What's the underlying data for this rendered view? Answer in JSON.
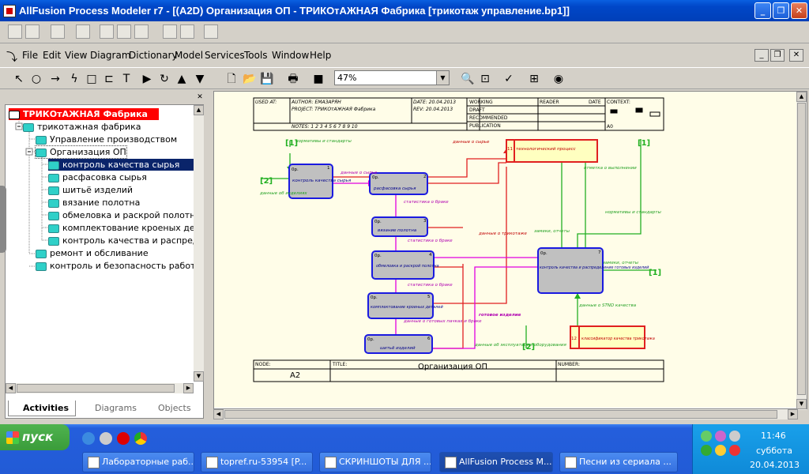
{
  "window": {
    "title": "AllFusion Process Modeler r7 - [(A2D) Организация ОП - ТРИКОтАЖНАЯ Фабрика  [трикотаж управление.bp1]]"
  },
  "menu": [
    "File",
    "Edit",
    "View",
    "Diagram",
    "Dictionary",
    "Model",
    "Services",
    "Tools",
    "Window",
    "Help"
  ],
  "toolbar": {
    "zoom": "47%"
  },
  "tree": {
    "root": "ТРИКОтАЖНАЯ Фабрика",
    "items": [
      "трикотажная фабрика",
      "Управление производством",
      "Организация ОП",
      "контроль  качества  сырья",
      "расфасовка сырья",
      "шитьё изделий",
      "вязание  полотна",
      "обмеловка и  раскрой полотна",
      "комплектование  кроеных  дета",
      "контроль качества и  распреде",
      "ремонт и обсливание",
      "контроль и  безопасность работ"
    ]
  },
  "tabs": {
    "activities": "Activities",
    "diagrams": "Diagrams",
    "objects": "Objects"
  },
  "diagram": {
    "header": {
      "used_at": "USED AT:",
      "author": "AUTHOR:  ЕМАЗАРЯН",
      "project": "PROJECT:  ТРИКОтАЖНАЯ Фабрика",
      "date": "DATE: 20.04.2013",
      "rev": "REV:   20.04.2013",
      "notes": "NOTES:  1  2  3  4  5  6  7  8  9  10",
      "working": "WORKING",
      "draft": "DRAFT",
      "recommended": "RECOMMENDED",
      "publication": "PUBLICATION",
      "reader": "READER",
      "date2": "DATE",
      "context": "CONTEXT:",
      "a0": "A0"
    },
    "footer": {
      "node": "NODE:",
      "node_val": "A2",
      "title": "TITLE:",
      "title_val": "Организация ОП",
      "number": "NUMBER:"
    },
    "boxes": [
      {
        "text": "контроль качества сырья",
        "num": "1",
        "tag": "0р."
      },
      {
        "text": "расфасовка сырья",
        "num": "2",
        "tag": "0р."
      },
      {
        "text": "вязание  полотна",
        "num": "3",
        "tag": "0р."
      },
      {
        "text": "обмеловка и раскрой полотна",
        "num": "4",
        "tag": "0р."
      },
      {
        "text": "комплектование кроеных деталей",
        "num": "5",
        "tag": "0р."
      },
      {
        "text": "шитьё изделий",
        "num": "6",
        "tag": "0р."
      },
      {
        "text": "контроль качества и распределение готовых изделий",
        "num": "7",
        "tag": "0р."
      }
    ],
    "refs": [
      {
        "text": "технологический процесс",
        "num": "11"
      },
      {
        "text": "классификатор качества трикотажа",
        "num": "12"
      }
    ],
    "labels": [
      "нормативы и стандарты",
      "данные о сырье",
      "данные о сырье",
      "данные об изделиях",
      "статистика о браке",
      "статистика о браке",
      "статистика о браке",
      "данные о трикотаже",
      "отметка о выполнении",
      "нормативы и стандарты",
      "замеки, отчеты",
      "замеки, отчеты",
      "данные о готовых пачках и браке",
      "готовое изделие",
      "данные об эксплуатации оборудования",
      "данные о STND качества"
    ],
    "tunnels": [
      "[1]",
      "[1]",
      "[2]",
      "[1]",
      "[2]"
    ]
  },
  "taskbar": {
    "start": "пуск",
    "tasks": [
      "Лабораторные раб...",
      "topref.ru-53954 [P...",
      "СКРИНШОТЫ ДЛЯ ...",
      "AllFusion Process M...",
      "Песни из сериала ..."
    ],
    "time": "11:46",
    "day": "суббота",
    "date": "20.04.2013"
  }
}
